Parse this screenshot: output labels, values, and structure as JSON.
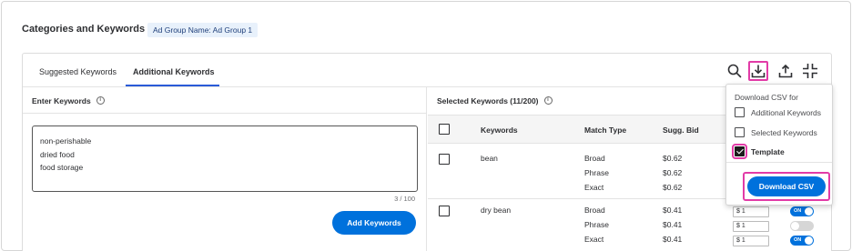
{
  "page": {
    "title": "Categories and Keywords",
    "ad_group_chip": "Ad Group Name: Ad Group 1"
  },
  "tabs": [
    {
      "label": "Suggested Keywords",
      "active": false
    },
    {
      "label": "Additional Keywords",
      "active": true
    }
  ],
  "toolbar": {
    "icons": [
      "search-icon",
      "download-icon",
      "upload-icon",
      "collapse-icon"
    ]
  },
  "left_pane": {
    "header": "Enter Keywords",
    "info_glyph": "i",
    "keywords": [
      "non-perishable",
      "dried food",
      "food storage"
    ],
    "counter": "3 / 100",
    "add_button": "Add Keywords"
  },
  "right_pane": {
    "header": "Selected Keywords (11/200)",
    "info_glyph": "i",
    "columns": {
      "keywords": "Keywords",
      "match_type": "Match Type",
      "sugg_bid": "Sugg. Bid"
    },
    "rows": [
      {
        "keyword": "bean",
        "matches": [
          {
            "type": "Broad",
            "bid": "$0.62"
          },
          {
            "type": "Phrase",
            "bid": "$0.62"
          },
          {
            "type": "Exact",
            "bid": "$0.62"
          }
        ]
      },
      {
        "keyword": "dry bean",
        "matches": [
          {
            "type": "Broad",
            "bid": "$0.41",
            "bid_input": "$ 1",
            "toggle": "on",
            "toggle_label": "ON"
          },
          {
            "type": "Phrase",
            "bid": "$0.41",
            "bid_input": "$ 1",
            "toggle": "off"
          },
          {
            "type": "Exact",
            "bid": "$0.41",
            "bid_input": "$ 1",
            "toggle": "on",
            "toggle_label": "ON"
          }
        ]
      }
    ]
  },
  "dropdown": {
    "title": "Download CSV for",
    "options": [
      {
        "label": "Additional Keywords",
        "checked": false
      },
      {
        "label": "Selected Keywords",
        "checked": false
      },
      {
        "label": "Template",
        "checked": true
      }
    ],
    "button": "Download CSV"
  },
  "colors": {
    "primary": "#0071dc",
    "highlight": "#e23ba7",
    "chip_bg": "#e8f1fb"
  }
}
